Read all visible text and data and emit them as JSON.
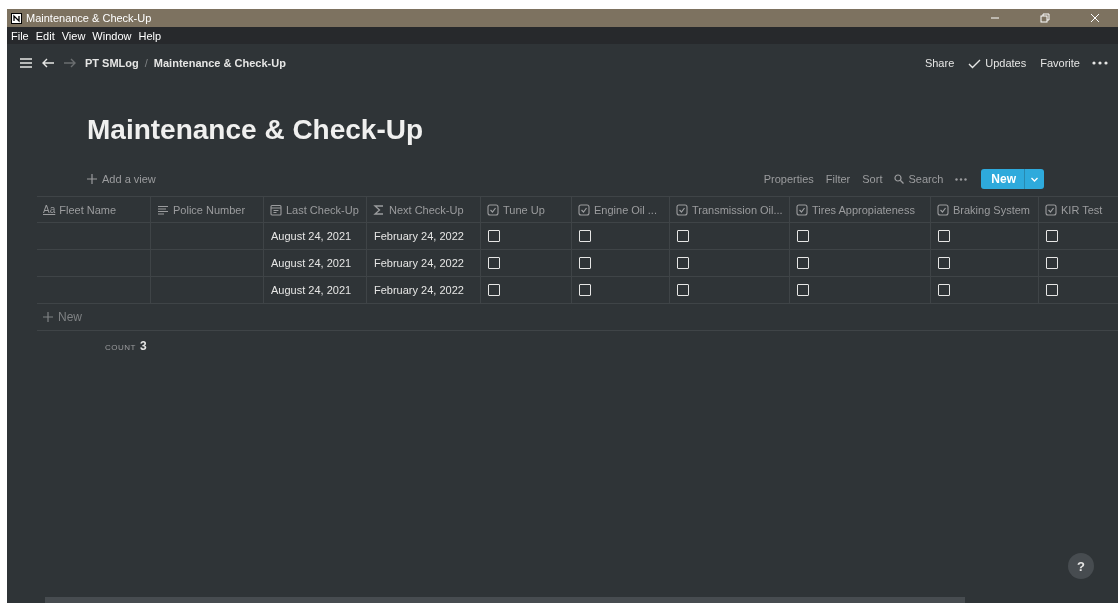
{
  "window": {
    "title": "Maintenance & Check-Up"
  },
  "menu": [
    "File",
    "Edit",
    "View",
    "Window",
    "Help"
  ],
  "topbar": {
    "breadcrumbs": [
      "PT SMLog",
      "Maintenance & Check-Up"
    ],
    "breadcrumb_separator": "/",
    "actions": [
      {
        "label": "Share",
        "kind": "plain"
      },
      {
        "label": "Updates",
        "kind": "check"
      },
      {
        "label": "Favorite",
        "kind": "plain"
      }
    ]
  },
  "page_title": "Maintenance & Check-Up",
  "view_bar": {
    "add_view": "Add a view",
    "tools": [
      {
        "label": "Properties",
        "kind": "plain"
      },
      {
        "label": "Filter",
        "kind": "plain"
      },
      {
        "label": "Sort",
        "kind": "plain"
      },
      {
        "label": "Search",
        "kind": "search"
      }
    ],
    "new_button": "New"
  },
  "table": {
    "columns": [
      {
        "label": "Fleet Name",
        "kind": "title",
        "icon_text": "Aa"
      },
      {
        "label": "Police Number",
        "kind": "text"
      },
      {
        "label": "Last Check-Up",
        "kind": "date"
      },
      {
        "label": "Next Check-Up",
        "kind": "formula"
      },
      {
        "label": "Tune Up",
        "kind": "checkbox"
      },
      {
        "label": "Engine Oil ...",
        "kind": "checkbox"
      },
      {
        "label": "Transmission Oil...",
        "kind": "checkbox"
      },
      {
        "label": "Tires Appropiateness",
        "kind": "checkbox"
      },
      {
        "label": "Braking System",
        "kind": "checkbox"
      },
      {
        "label": "KIR Test",
        "kind": "checkbox"
      }
    ],
    "rows": [
      {
        "dates": [
          "August 24, 2021",
          "February 24, 2022"
        ],
        "checks": [
          {
            "checked": false
          },
          {
            "checked": false
          },
          {
            "checked": false
          },
          {
            "checked": false
          },
          {
            "checked": false
          },
          {
            "checked": false
          }
        ]
      },
      {
        "dates": [
          "August 24, 2021",
          "February 24, 2022"
        ],
        "checks": [
          {
            "checked": false
          },
          {
            "checked": false
          },
          {
            "checked": false
          },
          {
            "checked": false
          },
          {
            "checked": false
          },
          {
            "checked": false
          }
        ]
      },
      {
        "dates": [
          "August 24, 2021",
          "February 24, 2022"
        ],
        "checks": [
          {
            "checked": false
          },
          {
            "checked": false
          },
          {
            "checked": false
          },
          {
            "checked": false
          },
          {
            "checked": false
          },
          {
            "checked": false
          }
        ]
      }
    ],
    "new_row": "New",
    "count": {
      "label": "COUNT",
      "value": "3"
    }
  },
  "help_button": "?"
}
